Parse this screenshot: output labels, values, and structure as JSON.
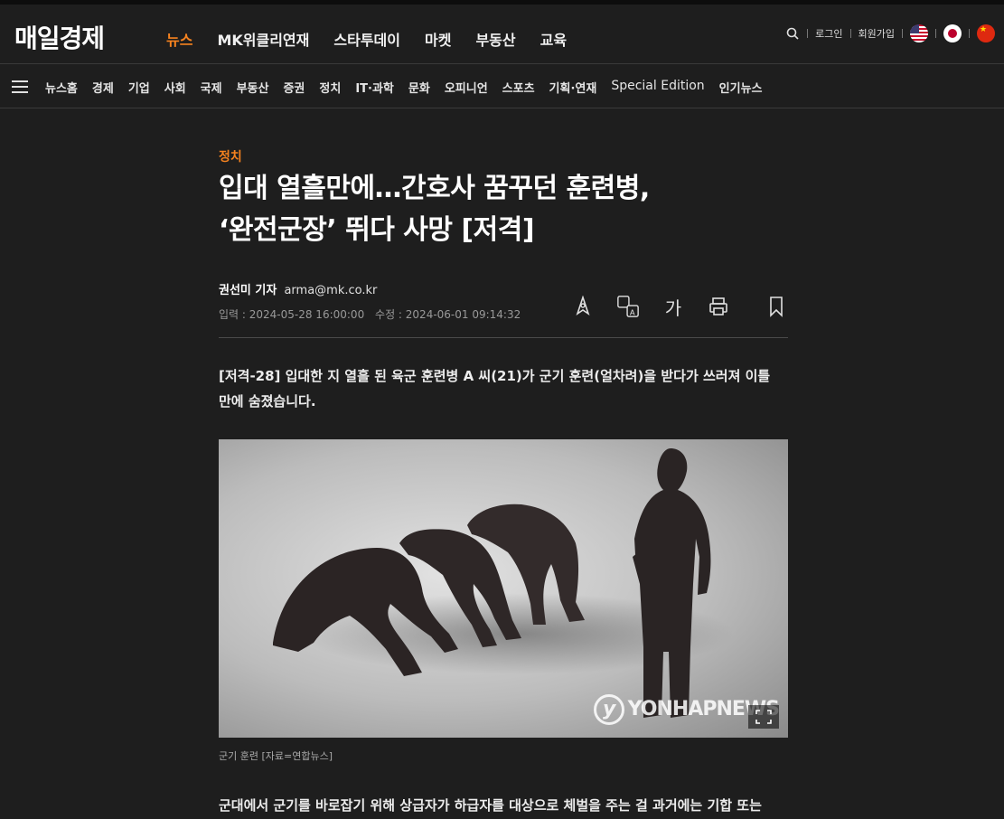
{
  "header": {
    "logo": "매일경제",
    "nav": [
      "뉴스",
      "MK위클리연재",
      "스타투데이",
      "마켓",
      "부동산",
      "교육"
    ],
    "active_nav": "뉴스",
    "login": "로그인",
    "signup": "회원가입",
    "accent_color": "#f5821f"
  },
  "subnav": {
    "items": [
      "뉴스홈",
      "경제",
      "기업",
      "사회",
      "국제",
      "부동산",
      "증권",
      "정치",
      "IT·과학",
      "문화",
      "오피니언",
      "스포츠",
      "기획·연재",
      "Special Edition",
      "인기뉴스"
    ]
  },
  "article": {
    "category": "정치",
    "headline_line1": "입대 열흘만에…간호사 꿈꾸던 훈련병,",
    "headline_line2": "‘완전군장’ 뛰다 사망 [저격]",
    "reporter": "권선미 기자",
    "email": "arma@mk.co.kr",
    "published": "입력 : 2024-05-28 16:00:00",
    "modified": "수정 : 2024-06-01 09:14:32",
    "font_size_label": "가",
    "lead_line1": "[저격-28] 입대한 지 열흘 된 육군 훈련병 A 씨(21)가 군기 훈련(얼차려)을 받다가 쓰러져 이틀",
    "lead_line2": "만에 숨졌습니다.",
    "photo_watermark": "YONHAPNEWS",
    "photo_watermark_letter": "y",
    "caption": "군기 훈련 [자료=연합뉴스]",
    "body_line1": "군대에서 군기를 바로잡기 위해 상급자가 하급자를 대상으로 체벌을 주는 걸 과거에는 기합 또는"
  }
}
